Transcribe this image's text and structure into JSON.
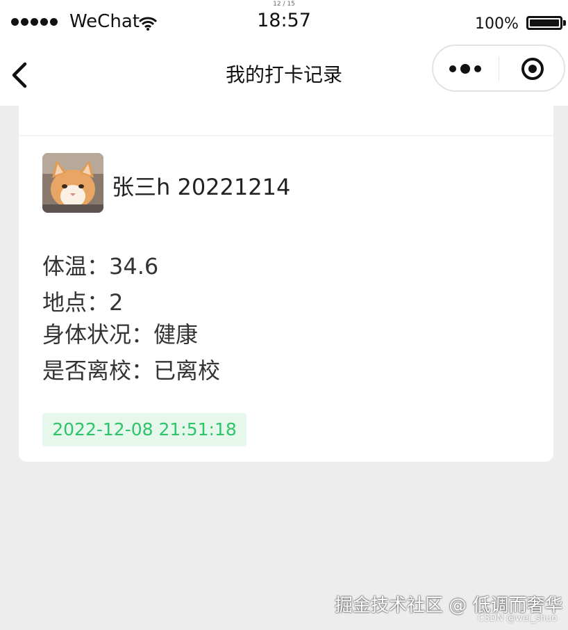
{
  "status_bar": {
    "top_mini": "12 / 15",
    "carrier": "WeChat",
    "time": "18:57",
    "battery_pct": "100%"
  },
  "nav": {
    "title": "我的打卡记录"
  },
  "record": {
    "username": "张三h 20221214",
    "temperature": "体温：34.6",
    "location": "地点：2",
    "health": "身体状况：健康",
    "left_school": "是否离校：已离校",
    "datetime": "2022-12-08 21:51:18"
  },
  "watermark": {
    "main": "掘金技术社区 @ 低调而奢华",
    "sub": "CSDN @wei_shuo"
  },
  "colors": {
    "accent_green": "#2ec46a",
    "badge_bg": "#e6f7ec",
    "page_bg": "#ededed"
  },
  "icons": [
    "signal-dots-icon",
    "wifi-icon",
    "battery-icon",
    "back-arrow-icon",
    "more-dots-icon",
    "close-circle-icon"
  ]
}
